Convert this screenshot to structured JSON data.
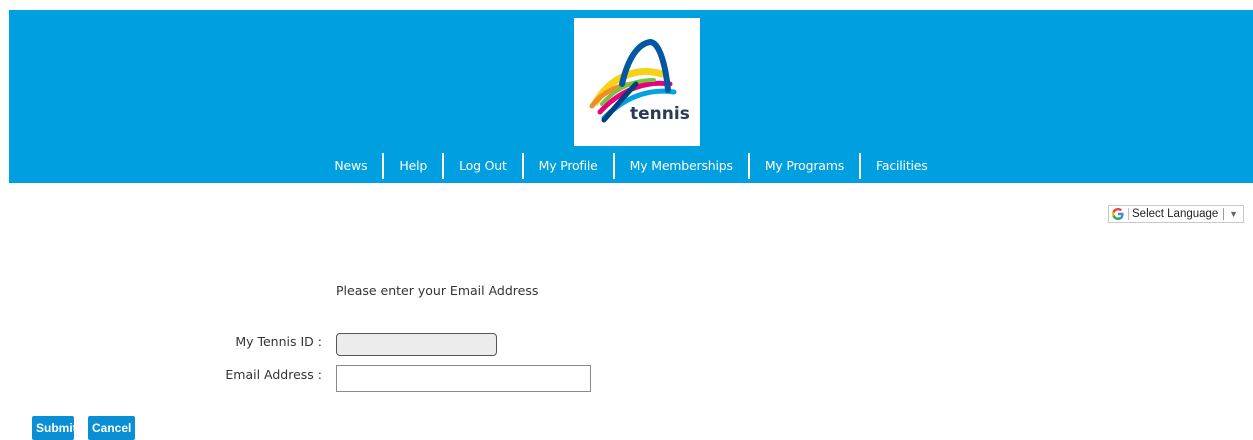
{
  "header": {
    "logo_text": "tennis",
    "background_color": "#009fe0"
  },
  "nav": {
    "items": [
      {
        "label": "News"
      },
      {
        "label": "Help"
      },
      {
        "label": "Log Out"
      },
      {
        "label": "My Profile"
      },
      {
        "label": "My Memberships"
      },
      {
        "label": "My Programs"
      },
      {
        "label": "Facilities"
      }
    ]
  },
  "language": {
    "label": "Select Language",
    "icon": "google-g-icon"
  },
  "form": {
    "prompt": "Please enter your Email Address",
    "tennis_id_label": "My Tennis ID :",
    "tennis_id_value": "",
    "email_label": "Email Address :",
    "email_value": ""
  },
  "actions": {
    "submit_label": "Submit",
    "cancel_label": "Cancel",
    "button_color": "#0b8fd4"
  }
}
